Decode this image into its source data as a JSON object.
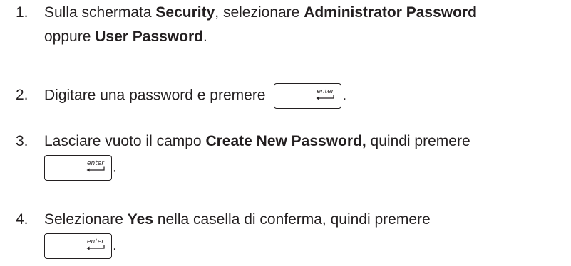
{
  "steps": [
    {
      "number": "1.",
      "segments": [
        "Sulla schermata ",
        "Security",
        ", selezionare ",
        "Administrator Password",
        "oppure ",
        "User Password",
        "."
      ]
    },
    {
      "number": "2.",
      "segments": [
        "Digitare una password e premere ",
        "."
      ]
    },
    {
      "number": "3.",
      "segments": [
        "Lasciare vuoto il campo ",
        "Create New Password,",
        " quindi premere",
        "."
      ]
    },
    {
      "number": "4.",
      "segments": [
        "Selezionare ",
        "Yes",
        " nella casella di conferma, quindi premere",
        "."
      ]
    }
  ],
  "key": {
    "label": "enter",
    "icon": "enter-arrow-icon"
  }
}
